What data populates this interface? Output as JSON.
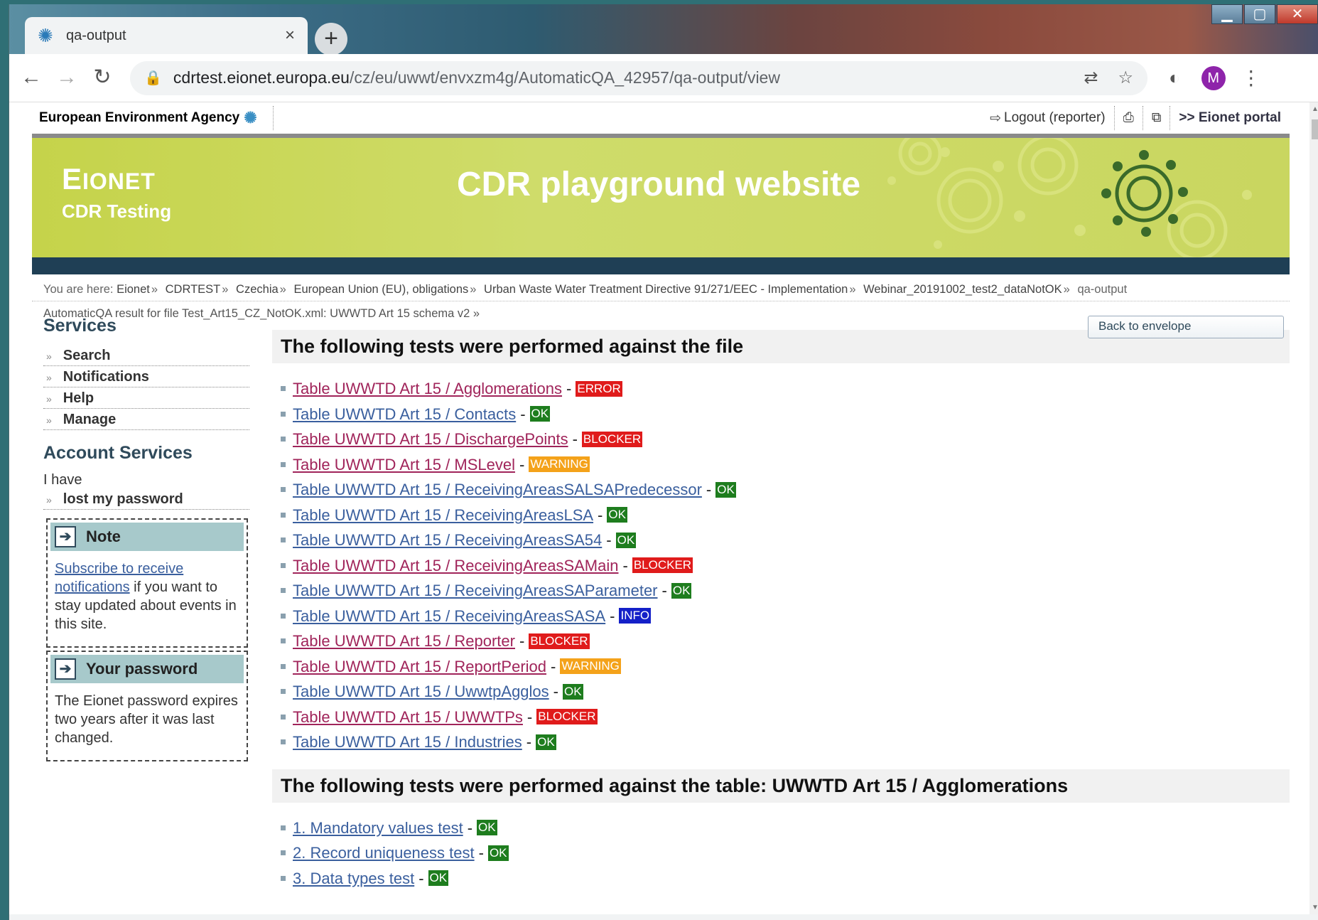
{
  "browser": {
    "tab_title": "qa-output",
    "url_host": "cdrtest.eionet.europa.eu",
    "url_path": "/cz/eu/uwwt/envxzm4g/AutomaticQA_42957/qa-output/view",
    "avatar_letter": "M"
  },
  "site": {
    "agency": "European Environment Agency",
    "logout": "Logout (reporter)",
    "portal": ">> Eionet portal",
    "brand_e": "E",
    "brand_rest": "IONET",
    "brand_sub": "CDR Testing",
    "site_name": "CDR playground website"
  },
  "breadcrumb": {
    "prefix": "You are here:",
    "items": [
      "Eionet",
      "CDRTEST",
      "Czechia",
      "European Union (EU), obligations",
      "Urban Waste Water Treatment Directive 91/271/EEC - Implementation",
      "Webinar_20191002_test2_dataNotOK"
    ],
    "current": "qa-output",
    "sub": "AutomaticQA result for file Test_Art15_CZ_NotOK.xml: UWWTD Art 15 schema v2"
  },
  "sidebar": {
    "services_title": "Services",
    "services": [
      "Search",
      "Notifications",
      "Help",
      "Manage"
    ],
    "account_title": "Account Services",
    "ihave": "I have",
    "lost_password": "lost my password",
    "note_title": "Note",
    "note_link": "Subscribe to receive notifications",
    "note_text": " if you want to stay updated about events in this site.",
    "password_title": "Your password",
    "password_text": "The Eionet password expires two years after it was last changed."
  },
  "main": {
    "back_button": "Back to envelope",
    "file_heading": "The following tests were performed against the file",
    "file_tests": [
      {
        "name": "Table UWWTD Art 15 / Agglomerations",
        "status": "ERROR"
      },
      {
        "name": "Table UWWTD Art 15 / Contacts",
        "status": "OK"
      },
      {
        "name": "Table UWWTD Art 15 / DischargePoints",
        "status": "BLOCKER"
      },
      {
        "name": "Table UWWTD Art 15 / MSLevel",
        "status": "WARNING"
      },
      {
        "name": "Table UWWTD Art 15 / ReceivingAreasSALSAPredecessor",
        "status": "OK"
      },
      {
        "name": "Table UWWTD Art 15 / ReceivingAreasLSA",
        "status": "OK"
      },
      {
        "name": "Table UWWTD Art 15 / ReceivingAreasSA54",
        "status": "OK"
      },
      {
        "name": "Table UWWTD Art 15 / ReceivingAreasSAMain",
        "status": "BLOCKER"
      },
      {
        "name": "Table UWWTD Art 15 / ReceivingAreasSAParameter",
        "status": "OK"
      },
      {
        "name": "Table UWWTD Art 15 / ReceivingAreasSASA",
        "status": "INFO"
      },
      {
        "name": "Table UWWTD Art 15 / Reporter",
        "status": "BLOCKER"
      },
      {
        "name": "Table UWWTD Art 15 / ReportPeriod",
        "status": "WARNING"
      },
      {
        "name": "Table UWWTD Art 15 / UwwtpAgglos",
        "status": "OK"
      },
      {
        "name": "Table UWWTD Art 15 / UWWTPs",
        "status": "BLOCKER"
      },
      {
        "name": "Table UWWTD Art 15 / Industries",
        "status": "OK"
      }
    ],
    "table_heading": "The following tests were performed against the table: UWWTD Art 15 / Agglomerations",
    "table_tests": [
      {
        "name": "1. Mandatory values test",
        "status": "OK"
      },
      {
        "name": "2. Record uniqueness test",
        "status": "OK"
      },
      {
        "name": "3. Data types test",
        "status": "OK"
      }
    ]
  }
}
